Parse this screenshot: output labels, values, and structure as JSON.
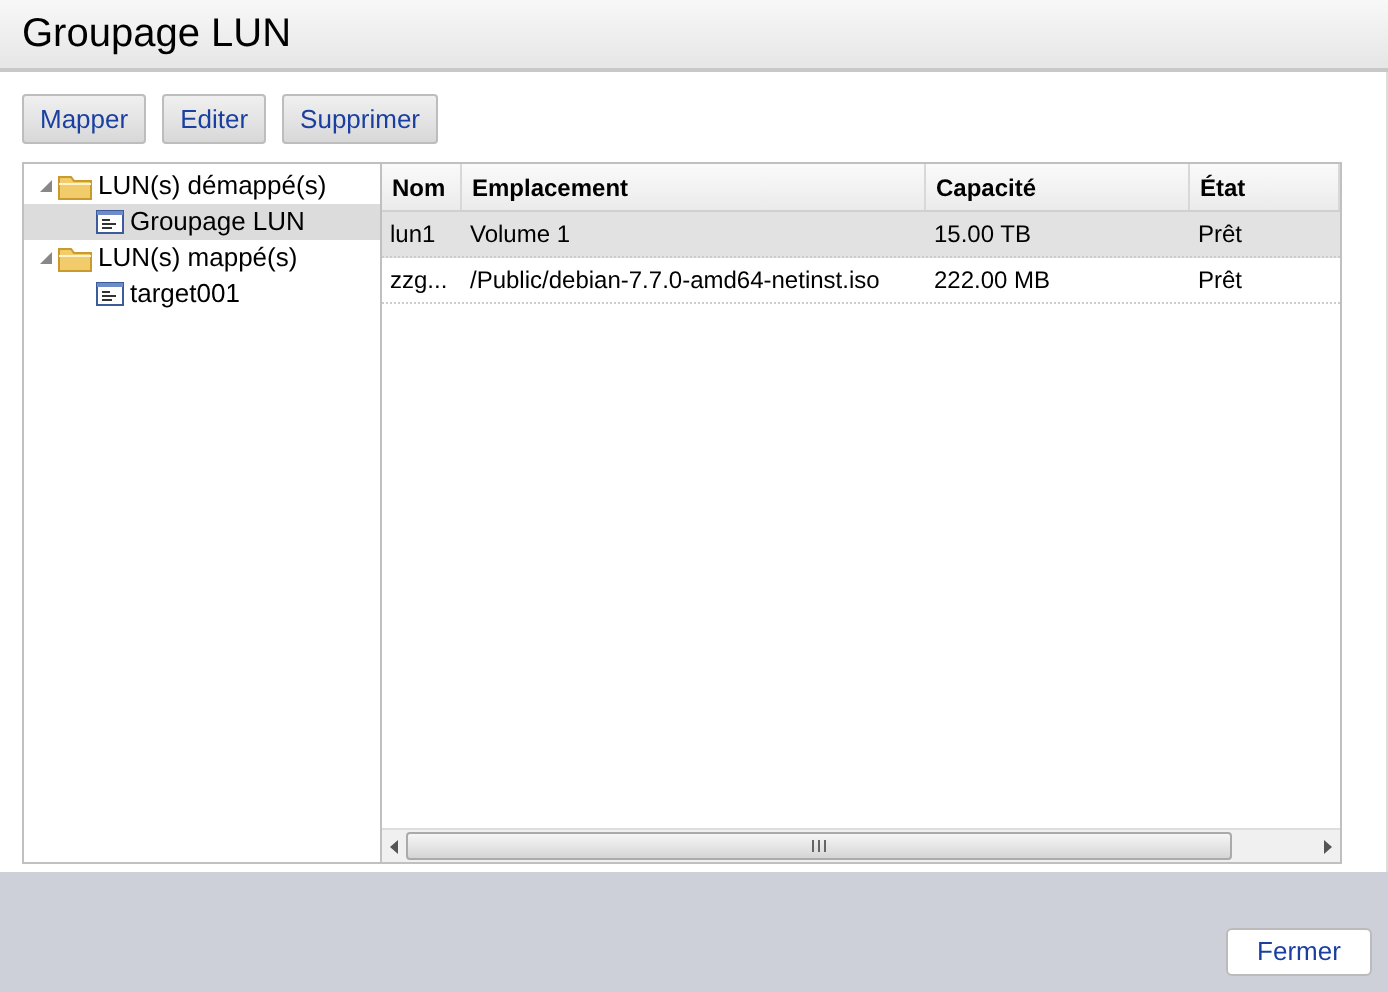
{
  "window": {
    "title": "Groupage LUN"
  },
  "toolbar": [
    "Mapper",
    "Editer",
    "Supprimer"
  ],
  "tree": [
    {
      "label": "LUN(s) démappé(s)",
      "kind": "folder",
      "expanded": true,
      "selected": false,
      "children": [
        {
          "label": "Groupage LUN",
          "kind": "lun",
          "selected": true
        }
      ]
    },
    {
      "label": "LUN(s) mappé(s)",
      "kind": "folder",
      "expanded": true,
      "selected": false,
      "children": [
        {
          "label": "target001",
          "kind": "lun",
          "selected": false
        }
      ]
    }
  ],
  "table": {
    "columns": [
      "Nom",
      "Emplacement",
      "Capacité",
      "État"
    ],
    "rows": [
      {
        "cells": [
          "lun1",
          "Volume 1",
          "15.00 TB",
          "Prêt"
        ],
        "selected": true
      },
      {
        "cells": [
          "zzg...",
          "/Public/debian-7.7.0-amd64-netinst.iso",
          "222.00 MB",
          "Prêt"
        ],
        "selected": false
      }
    ]
  },
  "footer": {
    "button": "Fermer"
  }
}
